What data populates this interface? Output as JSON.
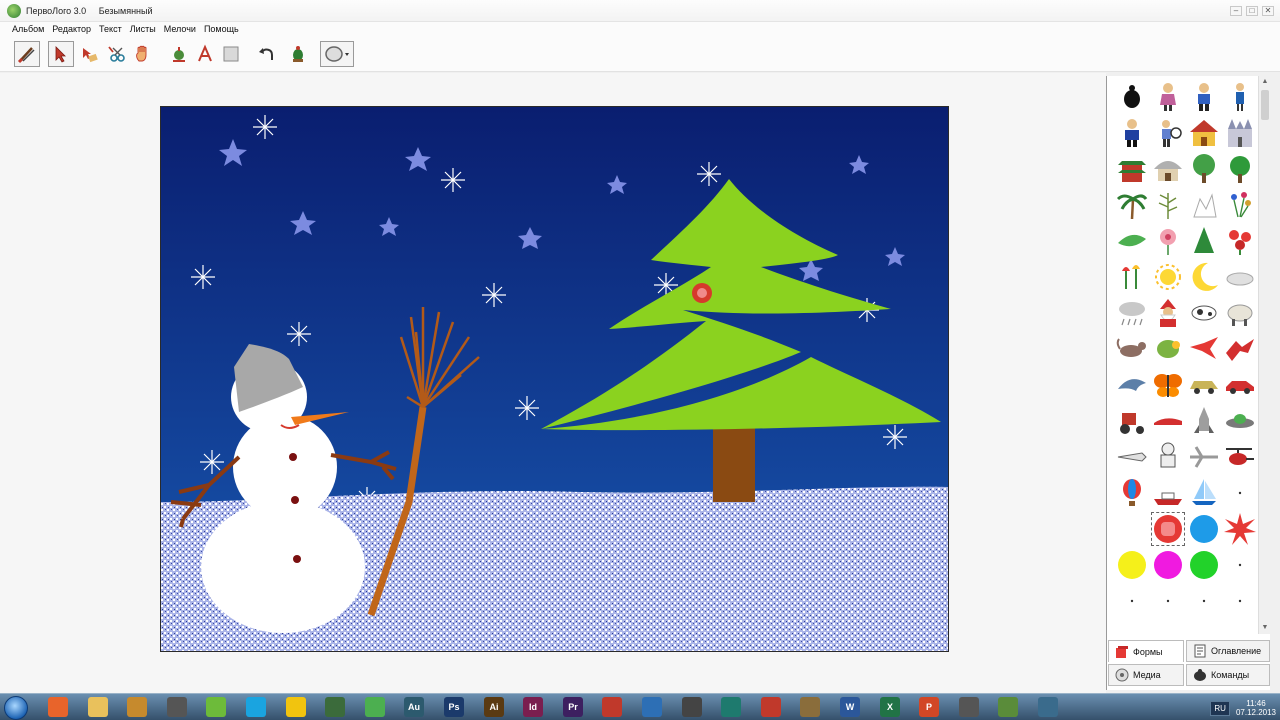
{
  "window": {
    "app_title": "ПервоЛого 3.0",
    "document_title": "Безымянный",
    "controls": [
      "–",
      "□",
      "✕"
    ]
  },
  "menu": {
    "items": [
      "Альбом",
      "Редактор",
      "Текст",
      "Листы",
      "Мелочи",
      "Помощь"
    ]
  },
  "toolbar": {
    "tools": [
      {
        "name": "brush-tool-icon",
        "icon": "brush"
      },
      {
        "name": "pointer-tool-icon",
        "icon": "pointer"
      },
      {
        "name": "eraser-tool-icon",
        "icon": "eraser"
      },
      {
        "name": "scissors-tool-icon",
        "icon": "scissors"
      },
      {
        "name": "hand-tool-icon",
        "icon": "hand"
      },
      {
        "name": "stamp-tool-icon",
        "icon": "stamp"
      },
      {
        "name": "text-tool-icon",
        "icon": "text-a"
      },
      {
        "name": "frame-tool-icon",
        "icon": "frame"
      },
      {
        "name": "undo-icon",
        "icon": "undo"
      },
      {
        "name": "turtle-tool-icon",
        "icon": "turtle"
      },
      {
        "name": "shape-select-icon",
        "icon": "ellipse"
      }
    ]
  },
  "panel": {
    "tabs": {
      "shapes": "Формы",
      "contents": "Оглавление",
      "media": "Медиа",
      "commands": "Команды"
    }
  },
  "taskbar": {
    "apps": [
      {
        "name": "firefox-taskbar-icon",
        "color": "#e8642b",
        "label": ""
      },
      {
        "name": "explorer-taskbar-icon",
        "color": "#e9c15c",
        "label": ""
      },
      {
        "name": "media-taskbar-icon",
        "color": "#c68a2d",
        "label": ""
      },
      {
        "name": "tool-taskbar-icon",
        "color": "#555555",
        "label": ""
      },
      {
        "name": "torrent-taskbar-icon",
        "color": "#6dbb3a",
        "label": ""
      },
      {
        "name": "skype-taskbar-icon",
        "color": "#1aa4e0",
        "label": ""
      },
      {
        "name": "norton-taskbar-icon",
        "color": "#f1c40f",
        "label": ""
      },
      {
        "name": "app-taskbar-icon",
        "color": "#3b6b3b",
        "label": ""
      },
      {
        "name": "green-app-taskbar-icon",
        "color": "#4caf50",
        "label": ""
      },
      {
        "name": "audition-taskbar-icon",
        "color": "#2c5a6e",
        "label": "Au"
      },
      {
        "name": "photoshop-taskbar-icon",
        "color": "#1b3a6b",
        "label": "Ps"
      },
      {
        "name": "illustrator-taskbar-icon",
        "color": "#5a3a12",
        "label": "Ai"
      },
      {
        "name": "indesign-taskbar-icon",
        "color": "#7a1e4f",
        "label": "Id"
      },
      {
        "name": "premiere-taskbar-icon",
        "color": "#3d2060",
        "label": "Pr"
      },
      {
        "name": "chrome-taskbar-icon",
        "color": "#c0392b",
        "label": ""
      },
      {
        "name": "player-taskbar-icon",
        "color": "#2d6fb5",
        "label": ""
      },
      {
        "name": "tool2-taskbar-icon",
        "color": "#444444",
        "label": ""
      },
      {
        "name": "sibelius-taskbar-icon",
        "color": "#1e7a6e",
        "label": ""
      },
      {
        "name": "acrobat-taskbar-icon",
        "color": "#c0392b",
        "label": ""
      },
      {
        "name": "archive-taskbar-icon",
        "color": "#8a6d3b",
        "label": ""
      },
      {
        "name": "word-taskbar-icon",
        "color": "#2b579a",
        "label": "W"
      },
      {
        "name": "excel-taskbar-icon",
        "color": "#217346",
        "label": "X"
      },
      {
        "name": "powerpoint-taskbar-icon",
        "color": "#d24726",
        "label": "P"
      },
      {
        "name": "app3-taskbar-icon",
        "color": "#555555",
        "label": ""
      },
      {
        "name": "pervologo-taskbar-icon",
        "color": "#5a8c3a",
        "label": ""
      },
      {
        "name": "app4-taskbar-icon",
        "color": "#3a6b8c",
        "label": ""
      }
    ],
    "lang": "RU",
    "time": "11:46",
    "date": "07.12.2013"
  }
}
